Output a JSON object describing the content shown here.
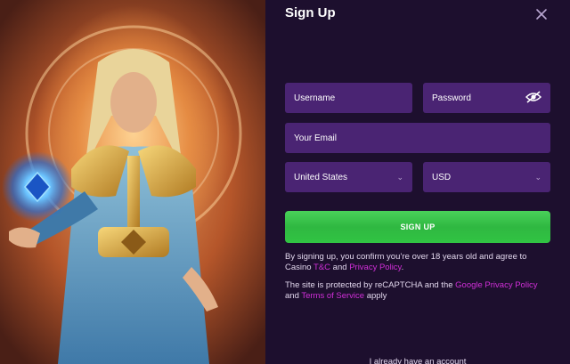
{
  "form": {
    "title": "Sign Up",
    "username_placeholder": "Username",
    "password_placeholder": "Password",
    "email_placeholder": "Your Email",
    "country_value": "United States",
    "currency_value": "USD",
    "submit_label": "SIGN UP"
  },
  "notice": {
    "age_text_1": "By signing up, you confirm you’re over 18 years old and agree to Casino ",
    "tc_link": "T&C",
    "age_text_2": " and ",
    "privacy_link": "Privacy Policy",
    "age_text_3": ".",
    "recaptcha_text_1": "The site is protected by reCAPTCHA and the ",
    "google_privacy_link": "Google Privacy Policy",
    "recaptcha_text_2": " and ",
    "terms_link": "Terms of Service",
    "recaptcha_text_3": " apply"
  },
  "footer": {
    "already_text": "I already have an account"
  },
  "icons": {
    "close": "close-icon",
    "eye": "eye-icon",
    "chevron": "chevron-down-icon"
  },
  "colors": {
    "background": "#1d0f2e",
    "field": "#4a2473",
    "accent_green": "#31c443",
    "link": "#d12fd8"
  }
}
